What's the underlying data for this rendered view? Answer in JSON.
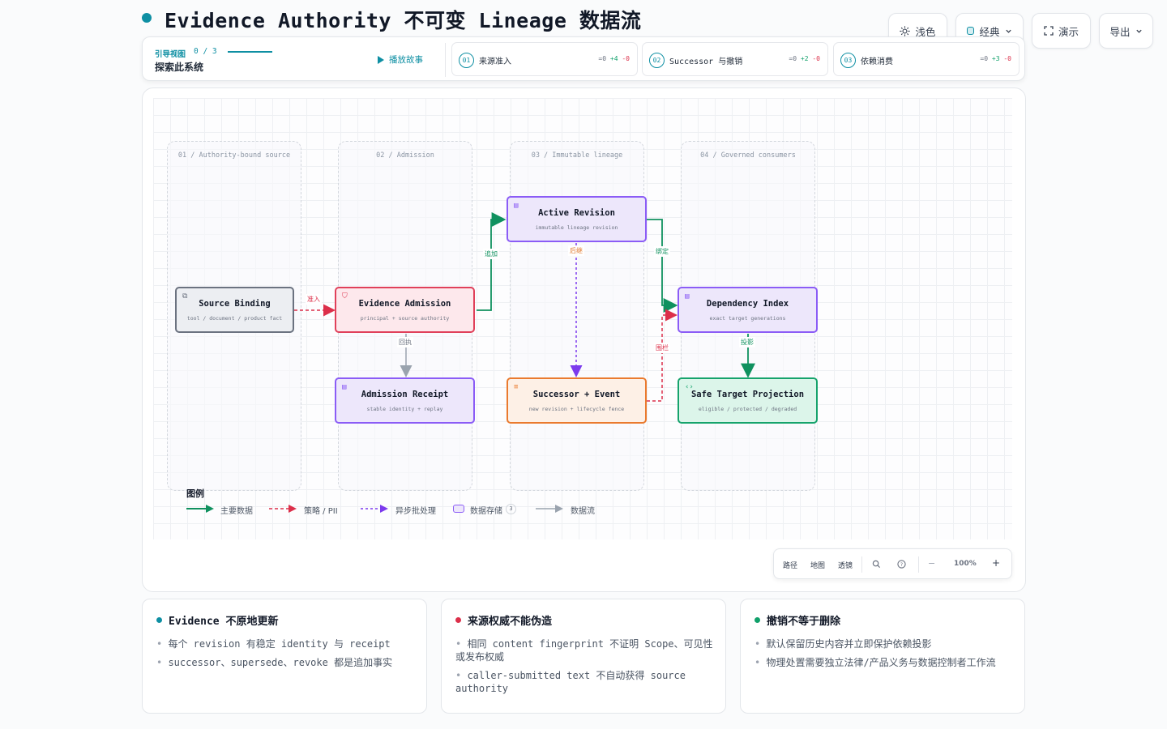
{
  "header": {
    "title": "Evidence Authority 不可变 Lineage 数据流"
  },
  "toolbar": {
    "theme_label": "浅色",
    "style_label": "经典",
    "present_label": "演示",
    "export_label": "导出"
  },
  "guide": {
    "label": "引导视图",
    "count": "0 / 3",
    "subtitle": "探索此系统",
    "play_label": "播放故事",
    "steps": [
      {
        "num": "01",
        "label": "来源准入",
        "eq": "=0",
        "plus": "+4",
        "minus": "-0"
      },
      {
        "num": "02",
        "label": "Successor 与撤销",
        "eq": "=0",
        "plus": "+2",
        "minus": "-0"
      },
      {
        "num": "03",
        "label": "依赖消费",
        "eq": "=0",
        "plus": "+3",
        "minus": "-0"
      }
    ]
  },
  "lanes": [
    {
      "title": "01 / Authority-bound source"
    },
    {
      "title": "02 / Admission"
    },
    {
      "title": "03 / Immutable lineage"
    },
    {
      "title": "04 / Governed consumers"
    }
  ],
  "nodes": {
    "source_binding": {
      "title": "Source Binding",
      "sub": "tool / document / product fact"
    },
    "evidence_admission": {
      "title": "Evidence Admission",
      "sub": "principal + source authority"
    },
    "admission_receipt": {
      "title": "Admission Receipt",
      "sub": "stable identity + replay"
    },
    "active_revision": {
      "title": "Active Revision",
      "sub": "immutable lineage revision"
    },
    "successor_event": {
      "title": "Successor + Event",
      "sub": "new revision + lifecycle fence"
    },
    "dependency_index": {
      "title": "Dependency Index",
      "sub": "exact target generations"
    },
    "safe_target": {
      "title": "Safe Target Projection",
      "sub": "eligible / protected / degraded"
    }
  },
  "edges": {
    "admit": "准入",
    "append": "追加",
    "receipt": "回执",
    "successor": "后继",
    "bind": "绑定",
    "fence": "围栏",
    "project": "投影"
  },
  "legend": {
    "title": "图例",
    "primary": "主要数据",
    "policy": "策略 / PII",
    "async": "异步批处理",
    "store": "数据存储",
    "store_count": "3",
    "flow": "数据流"
  },
  "controls": {
    "path": "路径",
    "map": "地图",
    "lens": "透镜",
    "zoom": "100%",
    "minus": "−",
    "plus": "+"
  },
  "cards": [
    {
      "title": "Evidence 不原地更新",
      "color": "#0e8fa3",
      "items": [
        "每个 revision 有稳定 identity 与 receipt",
        "successor、supersede、revoke 都是追加事实"
      ]
    },
    {
      "title": "来源权威不能伪造",
      "color": "#dc2f4a",
      "items": [
        "相同 content fingerprint 不证明 Scope、可见性或发布权威",
        "caller-submitted text 不自动获得 source authority"
      ]
    },
    {
      "title": "撤销不等于删除",
      "color": "#10a06a",
      "items": [
        "默认保留历史内容并立即保护依赖投影",
        "物理处置需要独立法律/产品义务与数据控制者工作流"
      ]
    }
  ]
}
